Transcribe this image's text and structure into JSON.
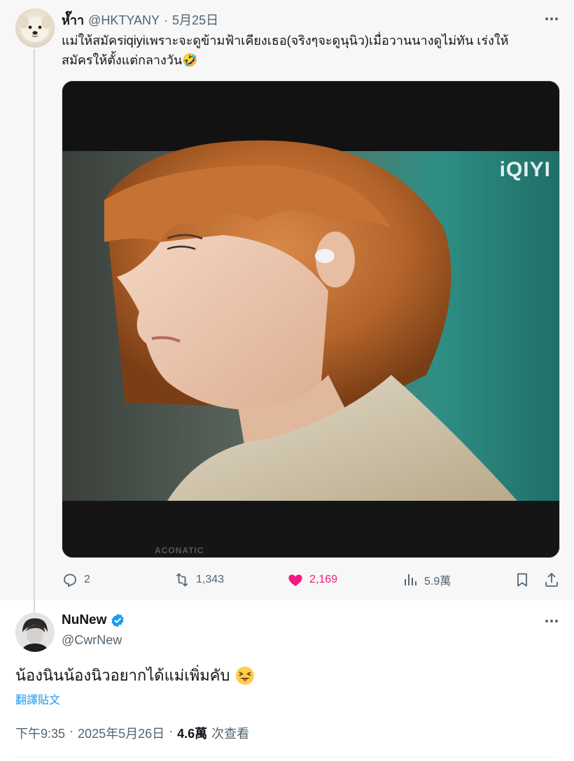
{
  "parent_tweet": {
    "display_name": "หํ๊าา",
    "handle": "@HKTYANY",
    "separator": "·",
    "date": "5月25日",
    "text_line1": "แม่ให้สมัครiqiyiเพราะจะดูข้ามฟ้าเคียงเธอ(จริงๆจะดูนุนิว)เมื่อวานนางดูไม่ทัน เร่งให้",
    "text_line2": "สมัครให้ตั้งแต่กลางวัน🤣",
    "media": {
      "watermark": "iQIYI",
      "tv_brand": "ACONATIC"
    },
    "actions": {
      "replies": "2",
      "reposts": "1,343",
      "likes": "2,169",
      "views": "5.9萬"
    }
  },
  "main_tweet": {
    "display_name": "NuNew",
    "handle": "@CwrNew",
    "text": "น้องนินน้องนิวอยากได้แม่เพิ่มคับ",
    "translate_label": "翻譯貼文",
    "time": "下午9:35",
    "separator": "·",
    "date": "2025年5月26日",
    "separator2": "·",
    "views_count": "4.6萬",
    "views_label": "次查看"
  },
  "colors": {
    "like": "#f91880",
    "verified": "#1d9bf0",
    "secondary_text": "#536471",
    "link": "#1d9bf0"
  },
  "icons": [
    "more-icon",
    "reply-icon",
    "repost-icon",
    "like-icon",
    "views-icon",
    "bookmark-icon",
    "share-icon",
    "verified-icon",
    "squinting-tongue-emoji"
  ]
}
